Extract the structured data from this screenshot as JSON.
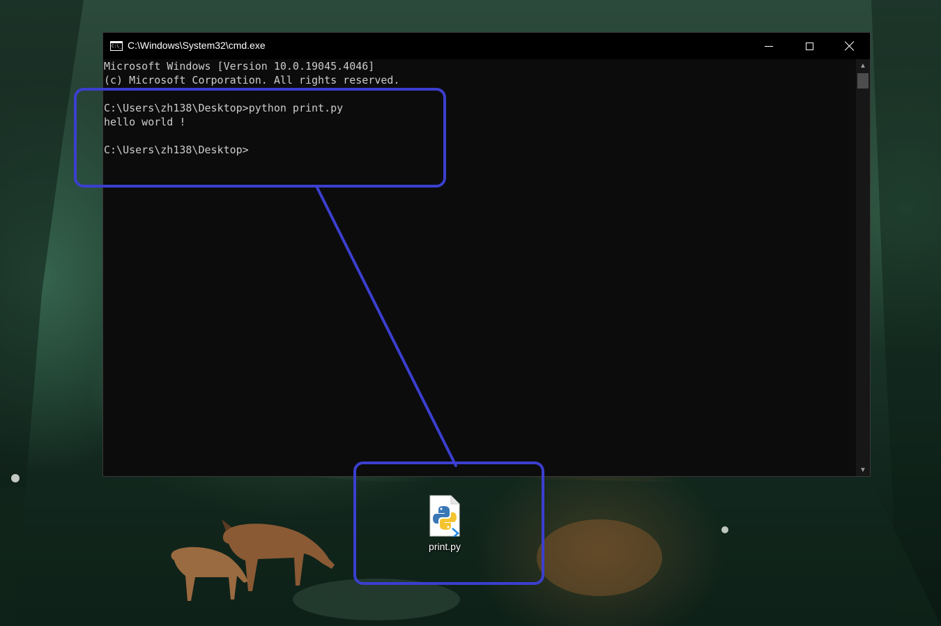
{
  "window": {
    "title": "C:\\Windows\\System32\\cmd.exe",
    "icon": "cmd-icon",
    "controls": [
      "minimize-icon",
      "maximize-icon",
      "close-icon"
    ]
  },
  "console": {
    "lines": [
      "Microsoft Windows [Version 10.0.19045.4046]",
      "(c) Microsoft Corporation. All rights reserved.",
      "",
      "C:\\Users\\zh138\\Desktop>python print.py",
      "hello world !",
      "",
      "C:\\Users\\zh138\\Desktop>"
    ]
  },
  "desktop": {
    "icon_label": "print.py",
    "icon": "python-file-icon"
  },
  "annotation": {
    "color": "#3b3fcf"
  }
}
